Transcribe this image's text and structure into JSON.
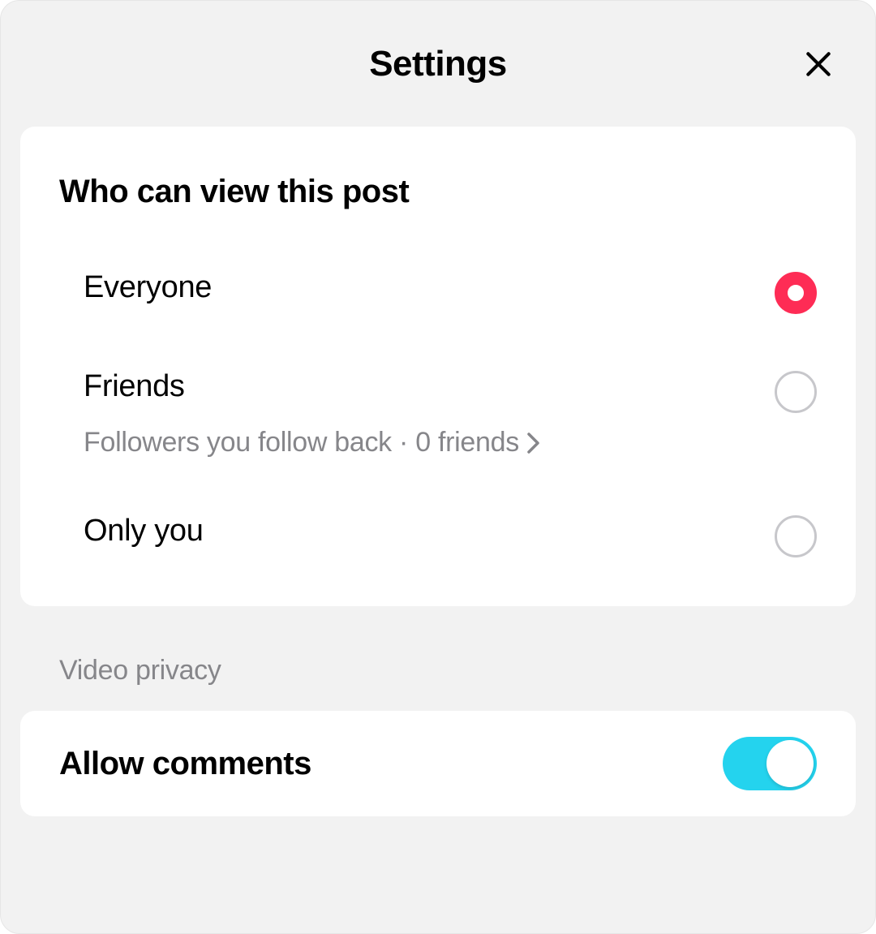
{
  "header": {
    "title": "Settings"
  },
  "visibility": {
    "section_title": "Who can view this post",
    "options": [
      {
        "label": "Everyone",
        "selected": true
      },
      {
        "label": "Friends",
        "sub": "Followers you follow back · 0 friends",
        "selected": false
      },
      {
        "label": "Only you",
        "selected": false
      }
    ]
  },
  "video_privacy": {
    "group_label": "Video privacy",
    "allow_comments": {
      "label": "Allow comments",
      "enabled": true
    }
  }
}
